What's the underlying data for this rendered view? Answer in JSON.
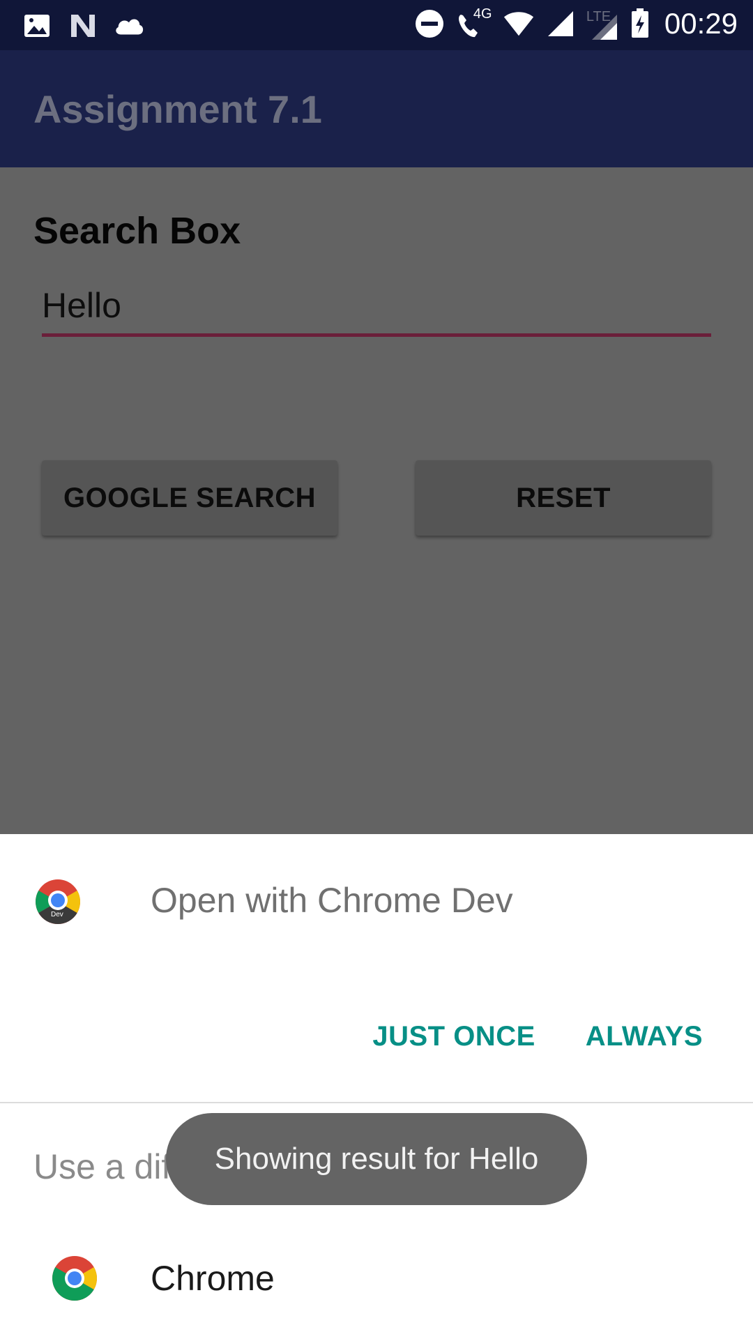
{
  "status_bar": {
    "time": "00:29",
    "icons_left": [
      "image-icon",
      "n-logo-icon",
      "cloud-icon"
    ],
    "icons_right": [
      "do-not-disturb-icon",
      "call-4g-icon",
      "wifi-icon",
      "lte-signal-icon",
      "signal-icon",
      "battery-charging-icon"
    ],
    "call_network": "4G",
    "lte_label": "LTE"
  },
  "app_bar": {
    "title": "Assignment 7.1"
  },
  "main": {
    "search_label": "Search Box",
    "search_value": "Hello",
    "google_search_label": "GOOGLE SEARCH",
    "reset_label": "RESET"
  },
  "chooser": {
    "open_with_title": "Open with Chrome Dev",
    "dev_badge": "Dev",
    "just_once_label": "JUST ONCE",
    "always_label": "ALWAYS",
    "use_different_app_label": "Use a different app",
    "apps": [
      {
        "label": "Chrome",
        "icon": "chrome-icon"
      }
    ]
  },
  "toast": {
    "message": "Showing result for Hello"
  },
  "colors": {
    "status_bar_bg": "#101638",
    "app_bar_bg": "#1a214a",
    "scrim_content": "#636363",
    "accent_teal": "#078f86",
    "input_underline": "#6b1f3a"
  }
}
